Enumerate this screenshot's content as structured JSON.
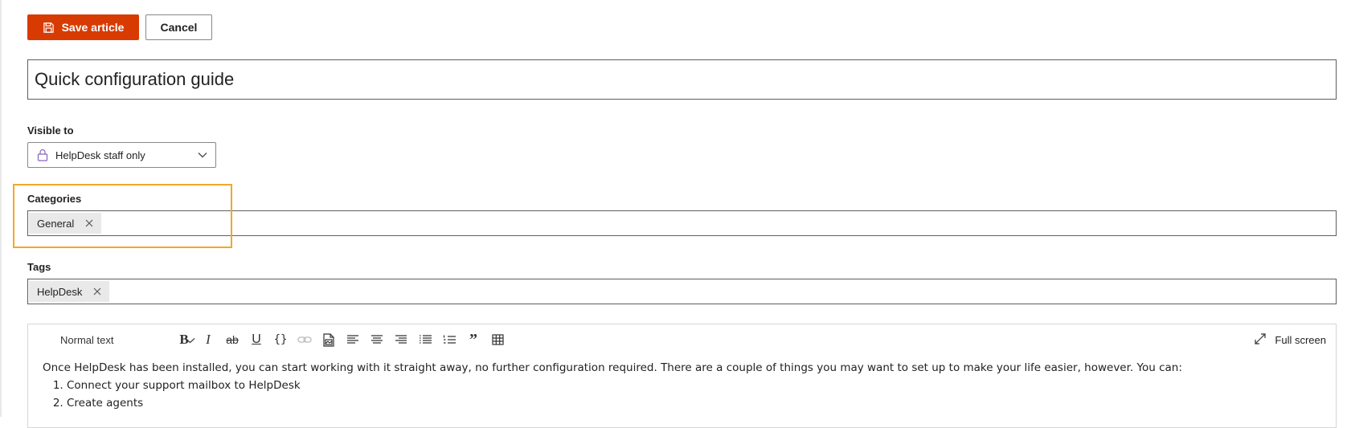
{
  "actions": {
    "save_label": "Save article",
    "cancel_label": "Cancel"
  },
  "article": {
    "title": "Quick configuration guide"
  },
  "visibility": {
    "label": "Visible to",
    "selected": "HelpDesk staff only",
    "icon": "lock-icon"
  },
  "categories": {
    "label": "Categories",
    "chips": [
      "General"
    ]
  },
  "tags": {
    "label": "Tags",
    "chips": [
      "HelpDesk"
    ]
  },
  "editor": {
    "format_select": "Normal text",
    "toolbar_icons": [
      "bold-icon",
      "italic-icon",
      "strikethrough-icon",
      "underline-icon",
      "code-icon",
      "link-icon",
      "image-icon",
      "align-left-icon",
      "align-center-icon",
      "align-right-icon",
      "bullet-list-icon",
      "numbered-list-icon",
      "quote-icon",
      "table-icon"
    ],
    "fullscreen_label": "Full screen",
    "body_paragraph": "Once HelpDesk has been installed, you can start working with it straight away, no further configuration required. There are a couple of things you may want to set up to make your life easier, however. You can:",
    "body_list": [
      "Connect your support mailbox to HelpDesk",
      "Create agents"
    ]
  },
  "colors": {
    "primary": "#d83b01",
    "highlight": "#f2a825",
    "lock_icon": "#8764b8"
  }
}
